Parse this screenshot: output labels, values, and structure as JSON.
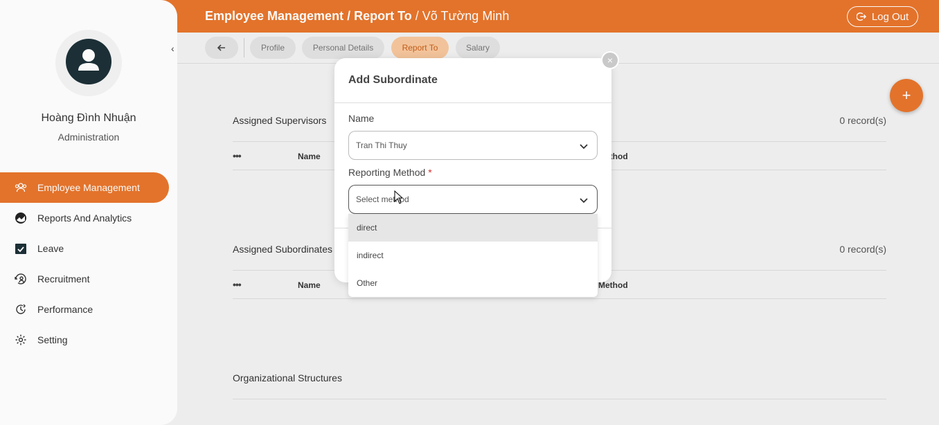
{
  "header": {
    "breadcrumb_1": "Employee Management",
    "breadcrumb_sep": " / ",
    "breadcrumb_2": "Report To",
    "breadcrumb_3": "Võ Tường Minh",
    "logout_label": "Log Out"
  },
  "sidebar": {
    "user_name": "Hoàng Đình Nhuận",
    "user_role": "Administration",
    "items": [
      {
        "label": "Employee Management",
        "icon": "users-icon",
        "active": true
      },
      {
        "label": "Reports And Analytics",
        "icon": "analytics-icon",
        "active": false
      },
      {
        "label": "Leave",
        "icon": "calendar-check-icon",
        "active": false
      },
      {
        "label": "Recruitment",
        "icon": "recruitment-icon",
        "active": false
      },
      {
        "label": "Performance",
        "icon": "performance-icon",
        "active": false
      },
      {
        "label": "Setting",
        "icon": "gear-icon",
        "active": false
      }
    ]
  },
  "tabs": [
    {
      "label": "Profile",
      "active": false
    },
    {
      "label": "Personal Details",
      "active": false
    },
    {
      "label": "Report To",
      "active": true
    },
    {
      "label": "Salary",
      "active": false
    }
  ],
  "main": {
    "supervisors": {
      "title": "Assigned Supervisors",
      "records": "0 record(s)",
      "col_dots": "•••",
      "col_name": "Name",
      "col_method": "Method"
    },
    "subordinates": {
      "title": "Assigned Subordinates",
      "records": "0 record(s)",
      "col_dots": "•••",
      "col_name": "Name",
      "col_method": "Method"
    },
    "org_title": "Organizational Structures",
    "fab_label": "+"
  },
  "modal": {
    "title": "Add Subordinate",
    "close_label": "×",
    "name_label": "Name",
    "name_value": "Tran Thi Thuy",
    "method_label": "Reporting Method",
    "method_required": "*",
    "method_placeholder": "Select method",
    "options": [
      "direct",
      "indirect",
      "Other"
    ]
  },
  "colors": {
    "accent": "#e8762c",
    "avatar_bg": "#1d3038"
  }
}
